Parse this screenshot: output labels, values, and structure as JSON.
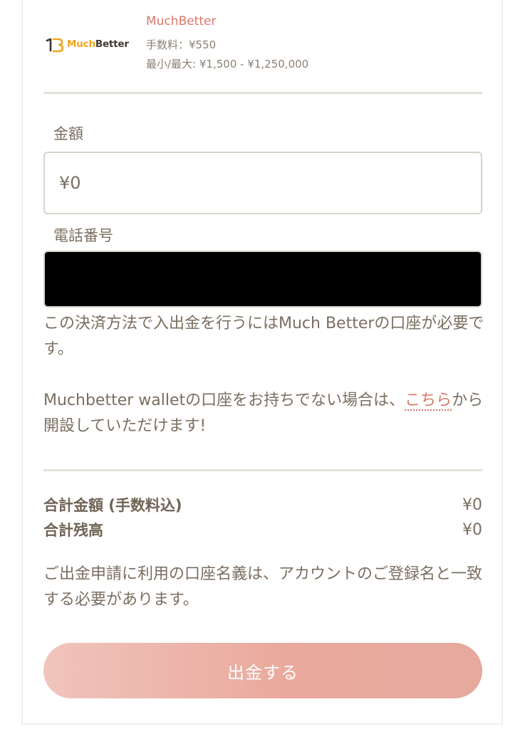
{
  "method": {
    "logo_prefix": "Much",
    "logo_suffix": "Better",
    "name": "MuchBetter",
    "fee": "手数料：¥550",
    "range": "最小/最大: ¥1,500 - ¥1,250,000"
  },
  "form": {
    "amount_label": "金額",
    "amount_value": "¥0",
    "phone_label": "電話番号",
    "phone_value": ""
  },
  "notes": {
    "requirement": "この決済方法で入出金を行うにはMuch Betterの口座が必要です。",
    "signup_prefix": "Muchbetter walletの口座をお持ちでない場合は、",
    "signup_link": "こちら",
    "signup_suffix": "から開設していただけます!"
  },
  "summary": {
    "total_label": "合計金額 (手数料込)",
    "total_value": "¥0",
    "balance_label": "合計残高",
    "balance_value": "¥0"
  },
  "disclaimer": "ご出金申請に利用の口座名義は、アカウントのご登録名と一致する必要があります。",
  "submit_label": "出金する",
  "colors": {
    "accent": "#d8786a",
    "logo_orange": "#f0a41e",
    "button_start": "#f0c4bc",
    "button_end": "#e5a99e",
    "text": "#7a6e60"
  }
}
